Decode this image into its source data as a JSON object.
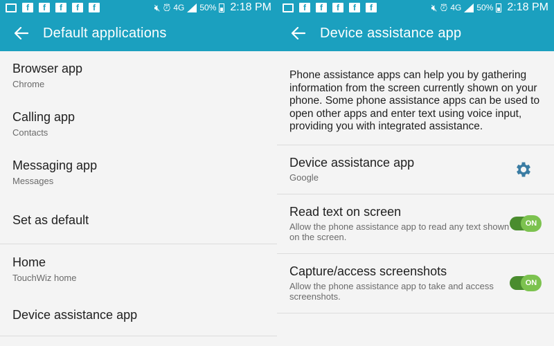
{
  "colors": {
    "accent": "#1ba0bf",
    "toggle_on": "#7cc24f",
    "toggle_track": "#4a8c2e",
    "gear": "#3a7ca3"
  },
  "left": {
    "status": {
      "battery": "50%",
      "time": "2:18 PM",
      "network": "4G"
    },
    "appbar": {
      "title": "Default applications"
    },
    "items": [
      {
        "title": "Browser app",
        "sub": "Chrome"
      },
      {
        "title": "Calling app",
        "sub": "Contacts"
      },
      {
        "title": "Messaging app",
        "sub": "Messages"
      },
      {
        "title": "Set as default"
      },
      {
        "title": "Home",
        "sub": "TouchWiz home"
      },
      {
        "title": "Device assistance app"
      }
    ]
  },
  "right": {
    "status": {
      "battery": "50%",
      "time": "2:18 PM",
      "network": "4G"
    },
    "appbar": {
      "title": "Device assistance app"
    },
    "description": "Phone assistance apps can help you by gathering information from the screen currently shown on your phone. Some phone assistance apps can be used to open other apps and enter text using voice input, providing you with integrated assistance.",
    "rows": [
      {
        "title": "Device assistance app",
        "sub": "Google"
      },
      {
        "title": "Read text on screen",
        "sub": "Allow the phone assistance app to read any text shown on the screen.",
        "toggle": "ON"
      },
      {
        "title": "Capture/access screenshots",
        "sub": "Allow the phone assistance app to take and access screenshots.",
        "toggle": "ON"
      }
    ]
  }
}
